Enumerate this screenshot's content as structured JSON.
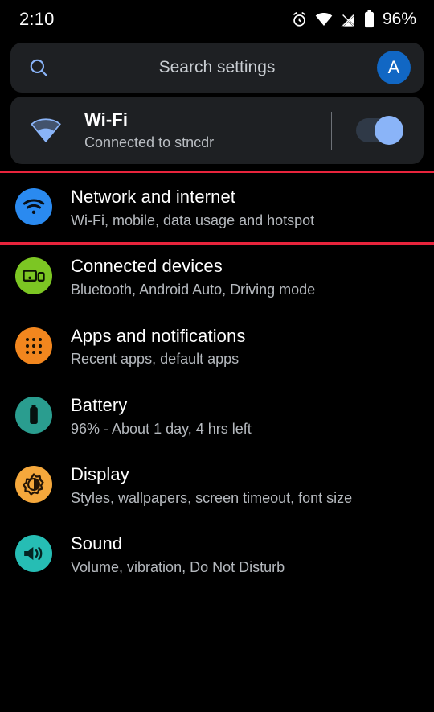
{
  "status_bar": {
    "time": "2:10",
    "battery_percent": "96%",
    "icons": [
      "alarm-icon",
      "wifi-icon",
      "cellular-no-signal-icon",
      "battery-icon"
    ]
  },
  "search": {
    "placeholder": "Search settings",
    "value": "",
    "icon": "search-icon",
    "avatar_letter": "A",
    "avatar_color": "#1167c4"
  },
  "wifi_card": {
    "icon": "wifi-icon",
    "title": "Wi-Fi",
    "subtitle": "Connected to stncdr",
    "toggle_state": "on",
    "toggle_color": "#8ab4f8"
  },
  "highlight": {
    "color": "#e8243c",
    "target": "Network and internet"
  },
  "settings_items": [
    {
      "title": "Network and internet",
      "subtitle": "Wi-Fi, mobile, data usage and hotspot",
      "icon": "network-wifi-icon",
      "icon_bg": "#2a8af0",
      "highlighted": true
    },
    {
      "title": "Connected devices",
      "subtitle": "Bluetooth, Android Auto, Driving mode",
      "icon": "connected-devices-icon",
      "icon_bg": "#7cc623",
      "highlighted": false
    },
    {
      "title": "Apps and notifications",
      "subtitle": "Recent apps, default apps",
      "icon": "apps-grid-icon",
      "icon_bg": "#f2861e",
      "highlighted": false
    },
    {
      "title": "Battery",
      "subtitle": "96% - About 1 day, 4 hrs left",
      "icon": "battery-icon",
      "icon_bg": "#2a9d8f",
      "highlighted": false
    },
    {
      "title": "Display",
      "subtitle": "Styles, wallpapers, screen timeout, font size",
      "icon": "brightness-icon",
      "icon_bg": "#f5a83c",
      "highlighted": false
    },
    {
      "title": "Sound",
      "subtitle": "Volume, vibration, Do Not Disturb",
      "icon": "speaker-icon",
      "icon_bg": "#26bdb4",
      "highlighted": false
    }
  ]
}
